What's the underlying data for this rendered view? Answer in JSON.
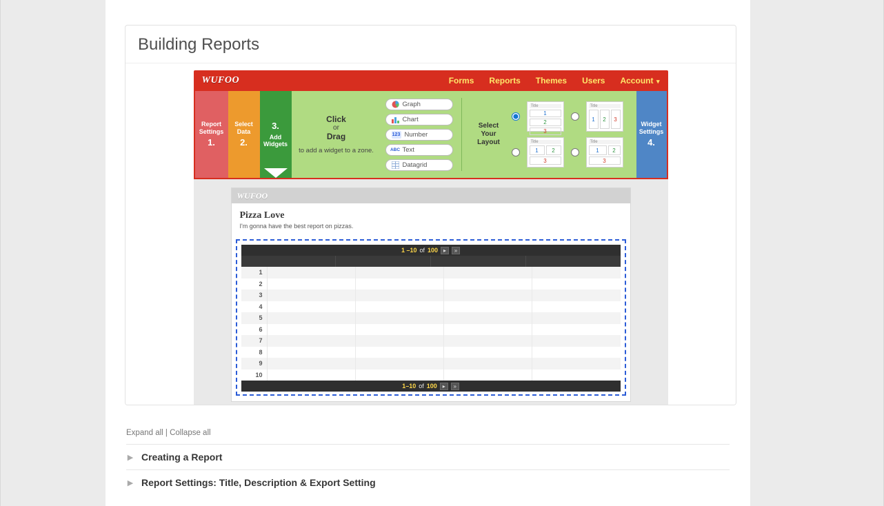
{
  "card": {
    "title": "Building Reports"
  },
  "wufoo": {
    "logo": "WUFOO",
    "nav": [
      "Forms",
      "Reports",
      "Themes",
      "Users",
      "Account"
    ],
    "steps": {
      "s1": {
        "label": "Report Settings",
        "num": "1."
      },
      "s2": {
        "label": "Select Data",
        "num": "2."
      },
      "s3": {
        "label": "Add Widgets",
        "num": "3."
      },
      "s4": {
        "label": "Widget Settings",
        "num": "4."
      }
    },
    "instruction": {
      "head": "Click",
      "or": "or",
      "head2": "Drag",
      "sub": "to add a widget to a zone."
    },
    "widgets": [
      "Graph",
      "Chart",
      "Number",
      "Text",
      "Datagrid"
    ],
    "layoutLabel": "Select Your Layout"
  },
  "report": {
    "logo": "WUFOO",
    "title": "Pizza Love",
    "subtitle": "I'm gonna have the best report on pizzas.",
    "pager": {
      "range_top": "1 –10",
      "range_bottom": "1–10",
      "of": "of",
      "total": "100"
    },
    "rows": [
      "1",
      "2",
      "3",
      "4",
      "5",
      "6",
      "7",
      "8",
      "9",
      "10"
    ]
  },
  "toc": {
    "expand": "Expand all",
    "collapse": "Collapse all",
    "sep": " | ",
    "items": [
      "Creating a Report",
      "Report Settings: Title, Description & Export Setting"
    ]
  }
}
